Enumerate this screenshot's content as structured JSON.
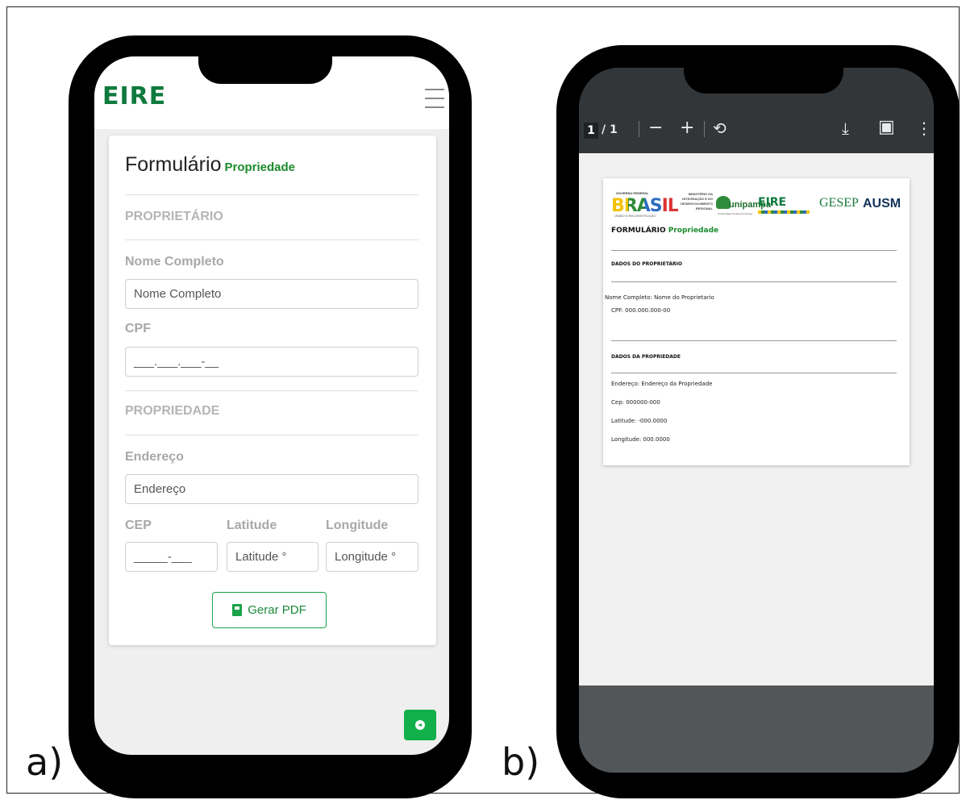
{
  "labels": {
    "a": "a)",
    "b": "b)"
  },
  "app": {
    "logo": "EIRE",
    "form_title": "Formulário",
    "form_subtitle": "Propriedade",
    "sections": {
      "owner": "PROPRIETÁRIO",
      "property": "PROPRIEDADE"
    },
    "fields": {
      "full_name": {
        "label": "Nome Completo",
        "placeholder": "Nome Completo"
      },
      "cpf": {
        "label": "CPF",
        "placeholder": "___.___.___-__"
      },
      "address": {
        "label": "Endereço",
        "placeholder": "Endereço"
      },
      "cep": {
        "label": "CEP",
        "placeholder": "_____-___"
      },
      "latitude": {
        "label": "Latitude",
        "placeholder": "Latitude °"
      },
      "longitude": {
        "label": "Longitude",
        "placeholder": "Longitude °"
      }
    },
    "generate_button": "Gerar PDF",
    "colors": {
      "accent": "#1aa34a",
      "logo": "#0f7a3d"
    }
  },
  "pdf_viewer": {
    "page_current": "1",
    "page_count": "/ 1",
    "icons": [
      "zoom-out-icon",
      "zoom-in-icon",
      "rotate-icon",
      "download-icon",
      "print-icon",
      "more-icon"
    ],
    "logos": {
      "governo": "GOVERNO FEDERAL",
      "brasil": "BRASIL",
      "brasil_sub": "UNIÃO E RECONSTRUÇÃO",
      "ministerio": "MINISTÉRIO DA INTEGRAÇÃO E DO DESENVOLVIMENTO REGIONAL",
      "unipampa": "unipampa",
      "unipampa_sub": "Universidade Federal do Pampa",
      "eire": "EIRE",
      "gesep": "GESEP",
      "ausm": "AUSM"
    },
    "document": {
      "title": "FORMULÁRIO",
      "title_sub": "Propriedade",
      "section_owner": "DADOS DO PROPRIETÁRIO",
      "owner_name": "Nome Completo: Nome do Proprietario",
      "owner_cpf": "CPF: 000.000.000-00",
      "section_property": "DADOS DA PROPRIEDADE",
      "address": "Endereço: Endereço da Propriedade",
      "cep": "Cep: 000000-000",
      "latitude": "Latitude: -000.0000",
      "longitude": "Longitude: 000.0000"
    }
  }
}
